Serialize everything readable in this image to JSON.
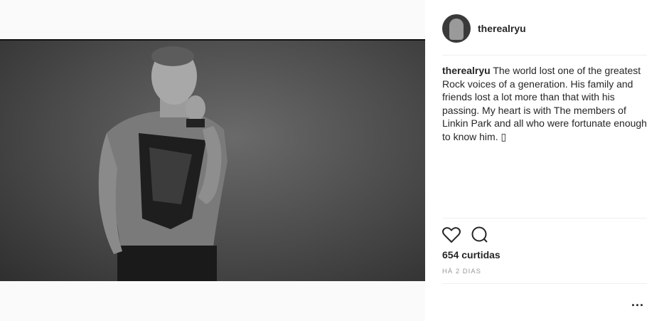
{
  "post": {
    "username": "therealryu",
    "caption": "The world lost one of the greatest Rock voices of a generation. His family and friends lost a lot more than that with his passing. My heart is with The members of Linkin Park and all who were fortunate enough to know him. ▯",
    "likes": "654 curtidas",
    "time": "HÁ 2 DIAS",
    "more_label": "..."
  },
  "icons": [
    "heart-icon",
    "comment-icon",
    "more-options-icon"
  ]
}
